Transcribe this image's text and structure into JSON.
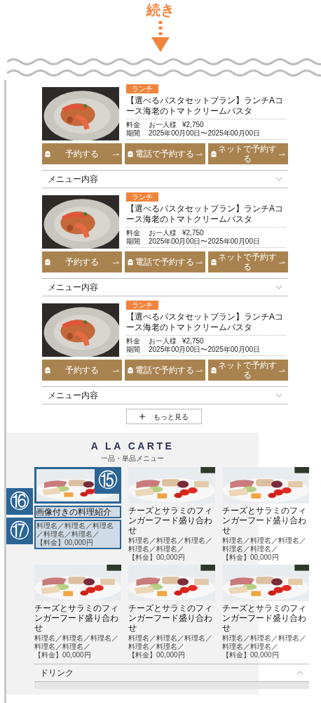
{
  "continue_label": "続き",
  "plans": [
    {
      "tag": "ランチ",
      "title": "【選べるパスタセットプラン】ランチAコース海老のトマトクリームパスタ",
      "price_label": "料金",
      "price_unit": "お一人様",
      "price": "¥2,750",
      "period_label": "期間",
      "period": "2025年00月00日〜2025年00月00日",
      "buttons": [
        "予約する",
        "電話で予約する",
        "ネットで予約する"
      ],
      "accordion": {
        "label": "メニュー内容",
        "expanded": false
      }
    },
    {
      "tag": "ランチ",
      "title": "【選べるパスタセットプラン】ランチAコース海老のトマトクリームパスタ",
      "price_label": "料金",
      "price_unit": "お一人様",
      "price": "¥2,750",
      "period_label": "期間",
      "period": "2025年00月00日〜2025年00月00日",
      "buttons": [
        "予約する",
        "電話で予約する",
        "ネットで予約する"
      ],
      "accordion": {
        "label": "メニュー内容",
        "expanded": false
      }
    },
    {
      "tag": "ランチ",
      "title": "【選べるパスタセットプラン】ランチAコース海老のトマトクリームパスタ",
      "price_label": "料金",
      "price_unit": "お一人様",
      "price": "¥2,750",
      "period_label": "期間",
      "period": "2025年00月00日〜2025年00月00日",
      "buttons": [
        "予約する",
        "電話で予約する",
        "ネットで予約する"
      ],
      "accordion": {
        "label": "メニュー内容",
        "expanded": false
      }
    }
  ],
  "more_button": "もっと見る",
  "a_la_carte": {
    "title": "A LA CARTE",
    "subtitle": "一品・単品メニュー",
    "items": [
      {
        "name": "画像付きの料理紹介",
        "dishes": "料理名／料理名／料理名／料理名／料理名／",
        "price": "【料金】00,000円",
        "callouts": {
          "image": "⑮",
          "title": "⑯",
          "details": "⑰"
        }
      },
      {
        "name": "チーズとサラミのフィンガーフード盛り合わせ",
        "dishes": "料理名／料理名／料理名／料理名／料理名／",
        "price": "【料金】00,000円"
      },
      {
        "name": "チーズとサラミのフィンガーフード盛り合わせ",
        "dishes": "料理名／料理名／料理名／料理名／料理名／",
        "price": "【料金】00,000円"
      },
      {
        "name": "チーズとサラミのフィンガーフード盛り合わせ",
        "dishes": "料理名／料理名／料理名／料理名／料理名／",
        "price": "【料金】00,000円"
      },
      {
        "name": "チーズとサラミのフィンガーフード盛り合わせ",
        "dishes": "料理名／料理名／料理名／料理名／料理名／",
        "price": "【料金】00,000円"
      },
      {
        "name": "チーズとサラミのフィンガーフード盛り合わせ",
        "dishes": "料理名／料理名／料理名／料理名／料理名／",
        "price": "【料金】00,000円"
      }
    ],
    "accordion": {
      "label": "ドリンク",
      "expanded": true
    }
  }
}
